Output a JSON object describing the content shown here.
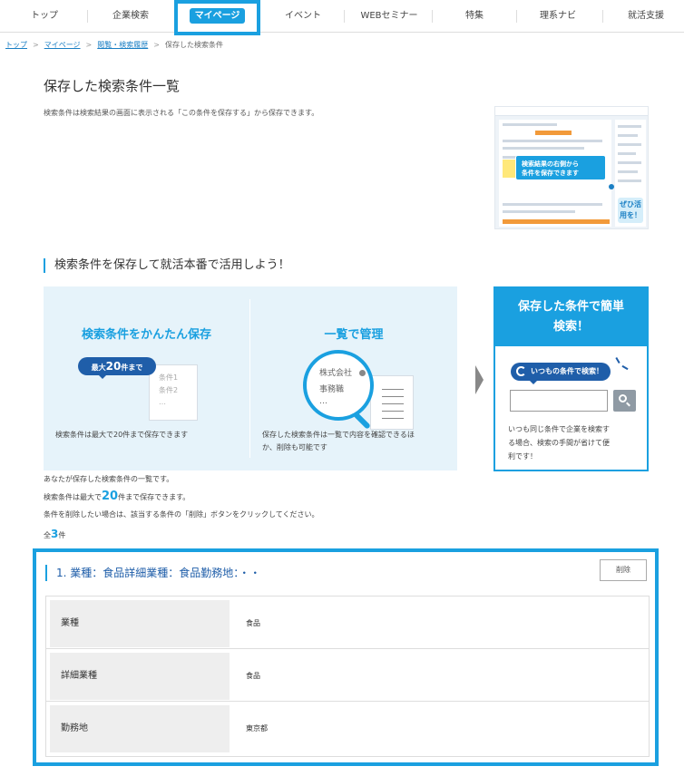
{
  "nav": {
    "items": [
      "トップ",
      "企業検索",
      "マイページ",
      "イベント",
      "WEBセミナー",
      "特集",
      "理系ナビ",
      "就活支援"
    ],
    "active": "マイページ"
  },
  "breadcrumb": {
    "items": [
      "トップ",
      "マイページ",
      "閲覧・検索履歴",
      "保存した検索条件"
    ],
    "separator": ">"
  },
  "page": {
    "title": "保存した検索条件一覧",
    "description": "検索条件は検索結果の画面に表示される「この条件を保存する」から保存できます。"
  },
  "thumbnail": {
    "callout_line1": "検索結果の右側から",
    "callout_line2": "条件を保存できます",
    "badge": "ぜひ活用を！"
  },
  "promo": {
    "heading": "検索条件を保存して就活本番で活用しよう！",
    "save": {
      "title": "検索条件をかんたん保存",
      "badge_prefix": "最大",
      "badge_num": "20",
      "badge_suffix": "件まで",
      "memo_lines": [
        "条件1",
        "条件2",
        "…"
      ],
      "caption": "検索条件は最大で20件まで保存できます"
    },
    "manage": {
      "title": "一覧で管理",
      "loupe_lines": [
        "株式会社",
        "事務職",
        "…"
      ],
      "caption_line1": "保存した検索条件は一覧で内容を確認できるほ",
      "caption_line2": "か、削除も可能です"
    },
    "easy": {
      "title_line1": "保存した条件で簡単",
      "title_line2": "検索！",
      "bubble": "いつもの条件で検索！",
      "desc_line1": "いつも同じ条件で企業を検索す",
      "desc_line2": "る場合、検索の手間が省けて便",
      "desc_line3": "利です！"
    }
  },
  "notes": {
    "line1": "あなたが保存した検索条件の一覧です。",
    "line2_prefix": "検索条件は最大で",
    "line2_num": "20",
    "line2_suffix": "件まで保存できます。",
    "line3": "条件を削除したい場合は、該当する条件の「削除」ボタンをクリックしてください。"
  },
  "count": {
    "prefix": "全",
    "num": "3",
    "suffix": "件"
  },
  "results": [
    {
      "title": "1. 業種：食品詳細業種：食品勤務地：・・",
      "delete_label": "削除",
      "rows": [
        {
          "label": "業種",
          "value": "食品"
        },
        {
          "label": "詳細業種",
          "value": "食品"
        },
        {
          "label": "勤務地",
          "value": "東京都"
        }
      ]
    }
  ],
  "colors": {
    "accent": "#1aa0e0",
    "navy": "#1f5ea9",
    "panel_bg": "#e6f3fa"
  }
}
